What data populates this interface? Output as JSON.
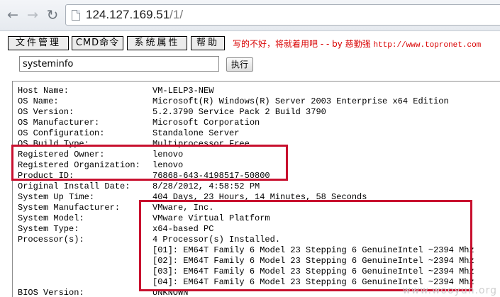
{
  "browser": {
    "url_host": "124.127.169.51",
    "url_path": "/1/",
    "back_glyph": "←",
    "forward_glyph": "→",
    "reload_glyph": "↻"
  },
  "menu": {
    "files": "文件管理",
    "cmd": "CMD命令",
    "props": "系统属性",
    "help": "帮助",
    "banner_text": "写的不好，将就着用吧 - - by 慈勤强 ",
    "banner_site": "http://www.topronet.com"
  },
  "command": {
    "input_value": "systeminfo",
    "exec_label": "执行"
  },
  "output_rows": [
    {
      "key": "Host Name:",
      "value": "VM-LELP3-NEW"
    },
    {
      "key": "OS Name:",
      "value": "Microsoft(R) Windows(R) Server 2003 Enterprise x64 Edition"
    },
    {
      "key": "OS Version:",
      "value": "5.2.3790 Service Pack 2 Build 3790"
    },
    {
      "key": "OS Manufacturer:",
      "value": "Microsoft Corporation"
    },
    {
      "key": "OS Configuration:",
      "value": "Standalone Server"
    },
    {
      "key": "OS Build Type:",
      "value": "Multiprocessor Free"
    },
    {
      "key": "Registered Owner:",
      "value": "lenovo"
    },
    {
      "key": "Registered Organization:",
      "value": "lenovo"
    },
    {
      "key": "Product ID:",
      "value": "76868-643-4198517-50800"
    },
    {
      "key": "Original Install Date:",
      "value": "8/28/2012, 4:58:52 PM"
    },
    {
      "key": "System Up Time:",
      "value": "404 Days, 23 Hours, 14 Minutes, 58 Seconds"
    },
    {
      "key": "System Manufacturer:",
      "value": "VMware, Inc."
    },
    {
      "key": "System Model:",
      "value": "VMware Virtual Platform"
    },
    {
      "key": "System Type:",
      "value": "x64-based PC"
    },
    {
      "key": "Processor(s):",
      "value": "4 Processor(s) Installed."
    },
    {
      "key": "",
      "value": "[01]: EM64T Family 6 Model 23 Stepping 6 GenuineIntel ~2394 Mhz"
    },
    {
      "key": "",
      "value": "[02]: EM64T Family 6 Model 23 Stepping 6 GenuineIntel ~2394 Mhz"
    },
    {
      "key": "",
      "value": "[03]: EM64T Family 6 Model 23 Stepping 6 GenuineIntel ~2394 Mhz"
    },
    {
      "key": "",
      "value": "[04]: EM64T Family 6 Model 23 Stepping 6 GenuineIntel ~2394 Mhz"
    },
    {
      "key": "BIOS Version:",
      "value": "UNKNOWN"
    }
  ],
  "watermark": "www.wooyun.org",
  "colors": {
    "highlight": "#c8102e",
    "banner": "#d90000"
  }
}
